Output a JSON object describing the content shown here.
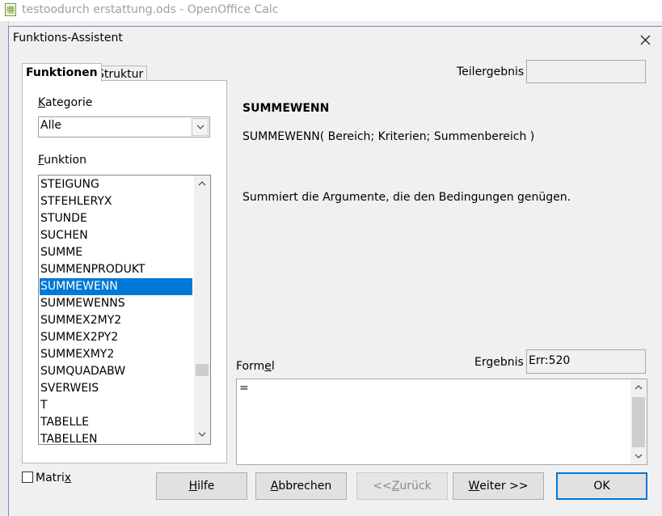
{
  "app": {
    "title": "testoodurch erstattung.ods - OpenOffice Calc"
  },
  "dialog": {
    "title": "Funktions-Assistent",
    "tabs": [
      "Funktionen",
      "Struktur"
    ],
    "category": {
      "label": "Kategorie",
      "value": "Alle"
    },
    "function_list": {
      "label": "Funktion",
      "items": [
        "STEIGUNG",
        "STFEHLERYX",
        "STUNDE",
        "SUCHEN",
        "SUMME",
        "SUMMENPRODUKT",
        "SUMMEWENN",
        "SUMMEWENNS",
        "SUMMEX2MY2",
        "SUMMEX2PY2",
        "SUMMEXMY2",
        "SUMQUADABW",
        "SVERWEIS",
        "T",
        "TABELLE",
        "TABELLEN"
      ],
      "selected": "SUMMEWENN"
    },
    "teilergebnis": {
      "label": "Teilergebnis",
      "value": ""
    },
    "function_info": {
      "name": "SUMMEWENN",
      "syntax": "SUMMEWENN( Bereich; Kriterien; Summenbereich )",
      "description": "Summiert die Argumente, die den Bedingungen genügen."
    },
    "ergebnis": {
      "label": "Ergebnis",
      "value": "Err:520"
    },
    "formel": {
      "label": "Formel",
      "value": "="
    },
    "matrix": {
      "label": "Matrix",
      "checked": false
    },
    "buttons": {
      "help": "Hilfe",
      "cancel": "Abbrechen",
      "back": "<< Zurück",
      "next": "Weiter >>",
      "ok": "OK"
    },
    "colors": {
      "selection": "#0078d7",
      "dialog_bg": "#f0f0f0"
    }
  }
}
